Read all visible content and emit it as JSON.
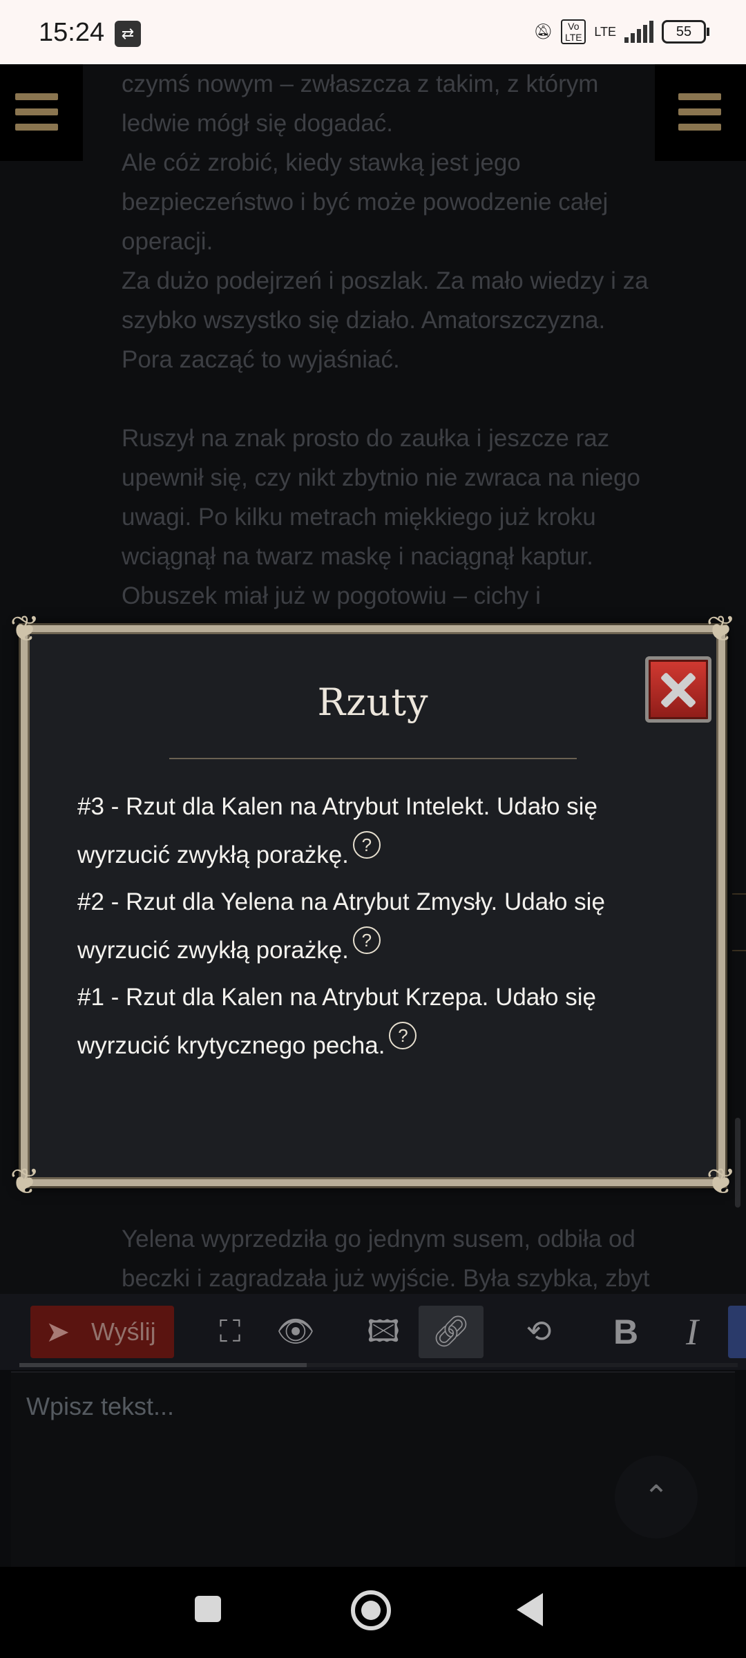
{
  "status_bar": {
    "time": "15:24",
    "network": "LTE",
    "volte": "Vo LTE",
    "battery": "55"
  },
  "story": {
    "lines": [
      "czymś nowym – zwłaszcza z takim, z którym",
      "ledwie mógł się dogadać.",
      "Ale cóż zrobić, kiedy stawką jest jego",
      "bezpieczeństwo i być może powodzenie całej",
      "operacji.",
      "Za dużo podejrzeń i poszlak. Za mało wiedzy i za",
      "szybko wszystko się działo. Amatorszczyzna.",
      "Pora zacząć to wyjaśniać.",
      "Ruszył na znak prosto do zaułka i jeszcze raz",
      "upewnił się, czy nikt zbytnio nie zwraca na niego",
      "uwagi. Po kilku metrach miękkiego już kroku",
      "wciągnął na twarz maskę i naciągnął kaptur.",
      "Obuszek miał już w pogotowiu – cichy i"
    ],
    "after_lines": [
      "Yelena wyprzedziła go jednym susem, odbiła od",
      "beczki i zagradzała już wyjście. Była szybka, zbyt"
    ]
  },
  "modal": {
    "title": "Rzuty",
    "rolls": [
      {
        "line1": "#3 - Rzut dla Kalen na Atrybut Intelekt. Udało się",
        "line2": "wyrzucić zwykłą porażkę."
      },
      {
        "line1": "#2 - Rzut dla Yelena na Atrybut Zmysły. Udało się",
        "line2": "wyrzucić zwykłą porażkę."
      },
      {
        "line1": "#1 - Rzut dla Kalen na Atrybut Krzepa. Udało się",
        "line2": "wyrzucić krytycznego pecha."
      }
    ],
    "help_symbol": "?"
  },
  "toolbar": {
    "send_label": "Wyślij",
    "bold_label": "B",
    "italic_label": "I",
    "progress": 0.4
  },
  "editor": {
    "placeholder": "Wpisz tekst..."
  },
  "colors": {
    "background": "#0d0e10",
    "modal_border": "#b8ad98",
    "send_button": "#5a1410",
    "close_button": "#c22e27"
  }
}
